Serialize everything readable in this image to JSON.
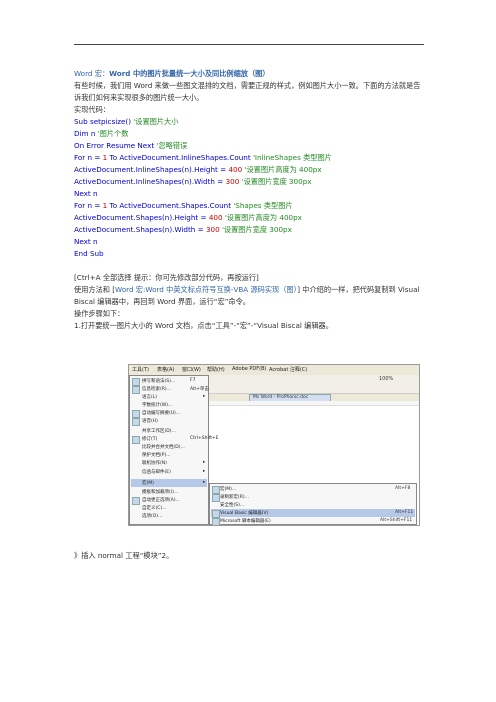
{
  "title": {
    "prefix": "Word 宏：",
    "main": "Word 中的图片批量统一大小及同比例缩放（图）"
  },
  "intro": "有些时候，我们用 Word 来做一些图文混排的文档，需要正规的样式，例如图片大小一致。下面的方法就是告诉我们如何来实现很多的图片统一大小。",
  "code_label": "实现代码：",
  "code": {
    "l1": "Sub setpicsize() '设置图片大小",
    "l2": "Dim n '图片个数",
    "l3": "On Error Resume Next '忽略错误",
    "l4": "For n = 1 To ActiveDocument.InlineShapes.Count 'InlineShapes 类型图片",
    "l5": "ActiveDocument.InlineShapes(n).Height = 400 '设置图片高度为 400px",
    "l6": "ActiveDocument.InlineShapes(n).Width = 300 '设置图片宽度 300px",
    "l7": "Next n",
    "l8": "For n = 1 To ActiveDocument.Shapes.Count 'Shapes 类型图片",
    "l9": "ActiveDocument.Shapes(n).Height = 400 '设置图片高度为 400px",
    "l10": "ActiveDocument.Shapes(n).Width = 300 '设置图片宽度 300px",
    "l11": "Next n",
    "l12": "End Sub"
  },
  "tip": "[Ctrl+A 全部选择 提示：你可先修改部分代码，再按运行]",
  "usage": {
    "prefix": "使用方法和 [",
    "link": "Word 宏:Word 中英文标点符号互换-VBA 源码实现（图）",
    "suffix": "] 中介绍的一样，把代码复制到 Visual Biscal 编辑器中，再回到 Word 界面，运行“宏”命令。"
  },
  "steps_label": "操作步骤如下：",
  "step1": "1.打开要统一图片大小的 Word 文档，点击“工具”-“宏”-“Visual Biscal 编辑器。",
  "screenshot": {
    "menubar": [
      "工具(T)",
      "表格(A)",
      "窗口(W)",
      "帮助(H)",
      "Adobe PDF(B)",
      "Acrobat 注释(C)"
    ],
    "tools_menu": [
      "拼写和语法(S)...",
      "信息检索(R)...",
      "语言(L)",
      "字数统计(W)...",
      "自动编写摘要(U)...",
      "语音(H)",
      "共享工作区(D)...",
      "修订(T)",
      "比较并合并文档(D)...",
      "保护文档(P)...",
      "联机协作(N)",
      "信函与邮件(E)",
      "宏(M)",
      "模板和加载项(I)...",
      "自动更正选项(A)...",
      "自定义(C)...",
      "选项(O)..."
    ],
    "shortcuts": {
      "spell": "F7",
      "research": "Alt+单击",
      "revise": "Ctrl+Shift+E"
    },
    "macro_submenu": [
      "宏(M)...",
      "录制新宏(R)...",
      "安全性(S)...",
      "Visual Basic 编辑器(V)",
      "Microsoft 脚本编辑器(E)"
    ],
    "macro_shortcuts": [
      "Alt+F8",
      "Alt+F11",
      "Alt+Shift+F11"
    ],
    "tab_label": "Ms Word - ProPhonic.doc",
    "zoom": "100%"
  },
  "footer": "》插入 normal 工程“模块”2。"
}
